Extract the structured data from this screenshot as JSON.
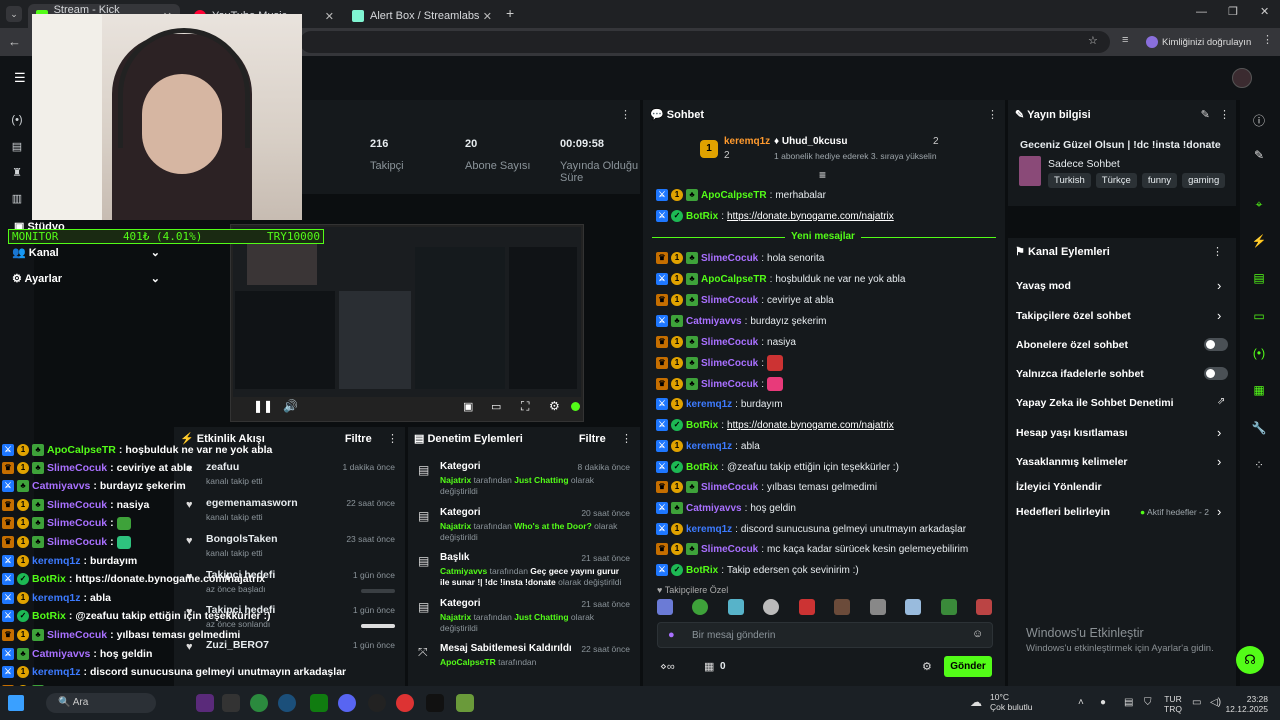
{
  "browser": {
    "tabs": [
      {
        "label": "Stream - Kick Dashboard",
        "active": true
      },
      {
        "label": "YouTube Music",
        "active": false
      },
      {
        "label": "Alert Box / Streamlabs",
        "active": false
      }
    ],
    "verify_label": "Kimliğinizi doğrulayın"
  },
  "stats": [
    {
      "value": "216",
      "label": "Takipçi"
    },
    {
      "value": "20",
      "label": "Abone Sayısı"
    },
    {
      "value": "00:09:58",
      "label": "Yayında Olduğu Süre"
    }
  ],
  "leftnav": {
    "studio_label": "Stüdyo",
    "channel_label": "Kanal",
    "settings_label": "Ayarlar"
  },
  "monitor": {
    "label": "MONITOR",
    "value": "401₺ (4.01%)",
    "goal": "TRY10000"
  },
  "chat": {
    "title": "Sohbet",
    "top_gifters": [
      {
        "rank": "1",
        "name": "keremq1z",
        "count": "2"
      },
      {
        "name": "Uhud_0kcusu",
        "count": "2",
        "note": "1 abonelik hediye ederek 3. sıraya yükselin"
      }
    ],
    "new_messages_label": "Yeni mesajlar",
    "messages": [
      {
        "user": "ApoCalpseTR",
        "text": "merhabalar",
        "color": "#53fc18",
        "badges": [
          "mod",
          "sub",
          "gift"
        ]
      },
      {
        "user": "BotRix",
        "text": "https://donate.bynogame.com/najatrix",
        "color": "#53fc18",
        "badges": [
          "mod",
          "bot"
        ],
        "link": true
      },
      {
        "user": "SlimeCocuk",
        "text": "hola senorita",
        "color": "#a970ff",
        "badges": [
          "vip",
          "sub",
          "gift"
        ]
      },
      {
        "user": "ApoCalpseTR",
        "text": "hoşbulduk ne var ne yok abla",
        "color": "#53fc18",
        "badges": [
          "mod",
          "sub",
          "gift"
        ]
      },
      {
        "user": "SlimeCocuk",
        "text": "ceviriye at abla",
        "color": "#a970ff",
        "badges": [
          "vip",
          "sub",
          "gift"
        ]
      },
      {
        "user": "Catmiyavvs",
        "text": "burdayız şekerim",
        "color": "#a970ff",
        "badges": [
          "mod",
          "gift"
        ]
      },
      {
        "user": "SlimeCocuk",
        "text": "nasiya",
        "color": "#a970ff",
        "badges": [
          "vip",
          "sub",
          "gift"
        ]
      },
      {
        "user": "SlimeCocuk",
        "text": "",
        "color": "#a970ff",
        "badges": [
          "vip",
          "sub",
          "gift"
        ],
        "emote": true
      },
      {
        "user": "SlimeCocuk",
        "text": "",
        "color": "#a970ff",
        "badges": [
          "vip",
          "sub",
          "gift"
        ],
        "emote2": true
      },
      {
        "user": "keremq1z",
        "text": "burdayım",
        "color": "#3d7bff",
        "badges": [
          "mod",
          "sub"
        ]
      },
      {
        "user": "BotRix",
        "text": "https://donate.bynogame.com/najatrix",
        "color": "#53fc18",
        "badges": [
          "mod",
          "bot"
        ],
        "link": true
      },
      {
        "user": "keremq1z",
        "text": "abla",
        "color": "#3d7bff",
        "badges": [
          "mod",
          "sub"
        ]
      },
      {
        "user": "BotRix",
        "text": "@zeafuu takip ettiğin için teşekkürler :)",
        "color": "#53fc18",
        "badges": [
          "mod",
          "bot"
        ]
      },
      {
        "user": "SlimeCocuk",
        "text": "yılbası teması gelmedimi",
        "color": "#a970ff",
        "badges": [
          "vip",
          "sub",
          "gift"
        ]
      },
      {
        "user": "Catmiyavvs",
        "text": "hoş geldin",
        "color": "#a970ff",
        "badges": [
          "mod",
          "gift"
        ]
      },
      {
        "user": "keremq1z",
        "text": "discord sunucusuna gelmeyi unutmayın arkadaşlar",
        "color": "#3d7bff",
        "badges": [
          "mod",
          "sub"
        ]
      },
      {
        "user": "SlimeCocuk",
        "text": "mc kaça kadar sürücek kesin gelemeyebilirim",
        "color": "#a970ff",
        "badges": [
          "vip",
          "sub",
          "gift"
        ]
      },
      {
        "user": "BotRix",
        "text": "Takip edersen çok sevinirim :)",
        "color": "#53fc18",
        "badges": [
          "mod",
          "bot"
        ]
      }
    ],
    "followers_label": "Takipçilere Özel",
    "input_placeholder": "Bir mesaj gönderin",
    "count": "0",
    "send_label": "Gönder"
  },
  "stream_info": {
    "title": "Yayın bilgisi",
    "stream_title": "Geceniz Güzel Olsun | !dc !insta !donate",
    "category": "Sadece Sohbet",
    "tags": [
      "Turkish",
      "Türkçe",
      "funny",
      "gaming"
    ]
  },
  "channel_actions": {
    "title": "Kanal Eylemleri",
    "items": [
      "Yavaş mod",
      "Takipçilere özel sohbet",
      "Abonelere özel sohbet",
      "Yalnızca ifadelerle sohbet",
      "Yapay Zeka ile Sohbet Denetimi",
      "Hesap yaşı kısıtlaması",
      "Yasaklanmış kelimeler",
      "İzleyici Yönlendir",
      "Hedefleri belirleyin"
    ],
    "goals_status": "Aktif hedefler - 2"
  },
  "activity": {
    "title": "Etkinlik Akışı",
    "filter": "Filtre",
    "items": [
      {
        "name": "zeafuu",
        "sub": "kanalı takip etti",
        "time": "1 dakika önce"
      },
      {
        "name": "egemenamasworn",
        "sub": "kanalı takip etti",
        "time": "22 saat önce"
      },
      {
        "name": "BongolsTaken",
        "sub": "kanalı takip etti",
        "time": "23 saat önce"
      },
      {
        "name": "Takipçi hedefi",
        "sub": "az önce başladı",
        "time": "1 gün önce"
      },
      {
        "name": "Takipçi hedefi",
        "sub": "az önce sonlandı",
        "time": "1 gün önce"
      },
      {
        "name": "Zuzi_BERO7",
        "sub": "",
        "time": "1 gün önce"
      }
    ]
  },
  "moderation": {
    "title": "Denetim Eylemleri",
    "filter": "Filtre",
    "items": [
      {
        "title": "Kategori",
        "time": "8 dakika önce",
        "actor": "Najatrix",
        "mid": "tarafından",
        "target": "Just Chatting",
        "end": "olarak değiştirildi"
      },
      {
        "title": "Kategori",
        "time": "20 saat önce",
        "actor": "Najatrix",
        "mid": "tarafından",
        "target": "Who's at the Door?",
        "end": "olarak değiştirildi"
      },
      {
        "title": "Başlık",
        "time": "21 saat önce",
        "actor": "Catmiyavvs",
        "mid": "tarafından",
        "target": "Geç gece yayını gurur ile sunar !| !dc !insta !donate",
        "end": "olarak değiştirildi"
      },
      {
        "title": "Kategori",
        "time": "21 saat önce",
        "actor": "Najatrix",
        "mid": "tarafından",
        "target": "Just Chatting",
        "end": "olarak değiştirildi"
      },
      {
        "title": "Mesaj Sabitlemesi Kaldırıldı",
        "time": "22 saat önce",
        "actor": "ApoCalpseTR",
        "mid": "tarafından",
        "target": "",
        "end": ""
      }
    ]
  },
  "overlay_chat": [
    {
      "user": "ApoCalpseTR",
      "text": "hoşbulduk ne var ne yok abla",
      "color": "#53fc18"
    },
    {
      "user": "SlimeCocuk",
      "text": "ceviriye at abla",
      "color": "#a970ff"
    },
    {
      "user": "Catmiyavvs",
      "text": "burdayız şekerim",
      "color": "#a970ff"
    },
    {
      "user": "SlimeCocuk",
      "text": "nasiya",
      "color": "#a970ff"
    },
    {
      "user": "SlimeCocuk",
      "text": "",
      "color": "#a970ff"
    },
    {
      "user": "SlimeCocuk",
      "text": "",
      "color": "#a970ff"
    },
    {
      "user": "keremq1z",
      "text": "burdayım",
      "color": "#3d7bff"
    },
    {
      "user": "BotRix",
      "text": "https://donate.bynogame.com/najatrix",
      "color": "#53fc18"
    },
    {
      "user": "keremq1z",
      "text": "abla",
      "color": "#3d7bff"
    },
    {
      "user": "BotRix",
      "text": "@zeafuu takip ettiğin için teşekkürler :)",
      "color": "#53fc18"
    },
    {
      "user": "SlimeCocuk",
      "text": "yılbası teması gelmedimi",
      "color": "#a970ff"
    },
    {
      "user": "Catmiyavvs",
      "text": "hoş geldin",
      "color": "#a970ff"
    },
    {
      "user": "keremq1z",
      "text": "discord sunucusuna gelmeyi unutmayın arkadaşlar",
      "color": "#3d7bff"
    },
    {
      "user": "SlimeCocuk",
      "text": "mc kaça kadar sürücek kesin gelemeyebilirim",
      "color": "#a970ff"
    },
    {
      "user": "BotRix",
      "text": "Takip edersen çok sevinirim :)",
      "color": "#53fc18"
    }
  ],
  "windows": {
    "activate_title": "Windows'u Etkinleştir",
    "activate_sub": "Windows'u etkinleştirmek için Ayarlar'a gidin."
  },
  "taskbar": {
    "search": "Ara",
    "weather_temp": "10°C",
    "weather_desc": "Çok bulutlu",
    "lang": "TUR",
    "lang2": "TRQ",
    "time": "23:28",
    "date": "12.12.2025"
  },
  "colors": {
    "accent": "#53fc18",
    "mod": "#1e77ff",
    "vip": "#a970ff"
  }
}
